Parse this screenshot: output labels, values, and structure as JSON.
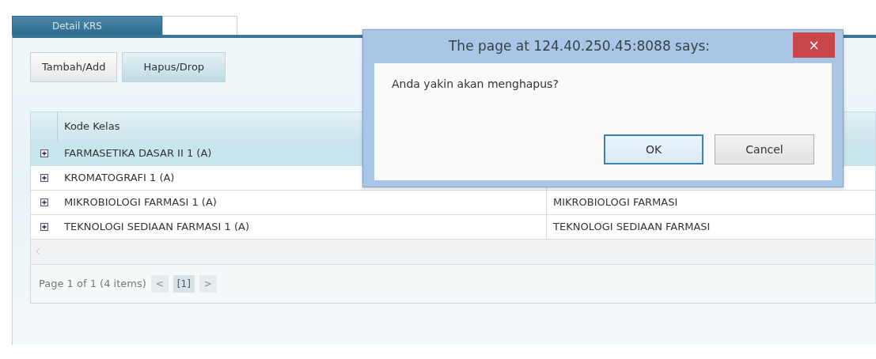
{
  "tabs": [
    {
      "label": "Detail KRS",
      "selected": true
    },
    {
      "selected": false
    }
  ],
  "toolbar": [
    {
      "label": "Tambah/Add",
      "active": false
    },
    {
      "label": "Hapus/Drop",
      "active": true
    }
  ],
  "grid": {
    "columns": [
      "Kode Kelas"
    ],
    "rows": [
      {
        "cells": [
          "FARMASETIKA DASAR II 1 (A)"
        ],
        "selected": true
      },
      {
        "cells": [
          "KROMATOGRAFI 1 (A)"
        ],
        "selected": false
      },
      {
        "cells": [
          "MIKROBIOLOGI FARMASI 1 (A)",
          "MIKROBIOLOGI FARMASI"
        ],
        "selected": false
      },
      {
        "cells": [
          "TEKNOLOGI SEDIAAN FARMASI 1 (A)",
          "TEKNOLOGI SEDIAAN FARMASI"
        ],
        "selected": false
      }
    ]
  },
  "pager": {
    "summary": "Page 1 of 1 (4 items)",
    "prev": {
      "label": "<",
      "disabled": true
    },
    "pages": [
      {
        "label": "[1]",
        "selected": true
      }
    ],
    "next": {
      "label": ">",
      "disabled": true
    }
  },
  "dialog": {
    "title": "The page at 124.40.250.45:8088 says:",
    "close": "×",
    "message": "Anda yakin akan menghapus?",
    "buttons": [
      {
        "label": "OK",
        "default": true
      },
      {
        "label": "Cancel",
        "default": false
      }
    ]
  }
}
